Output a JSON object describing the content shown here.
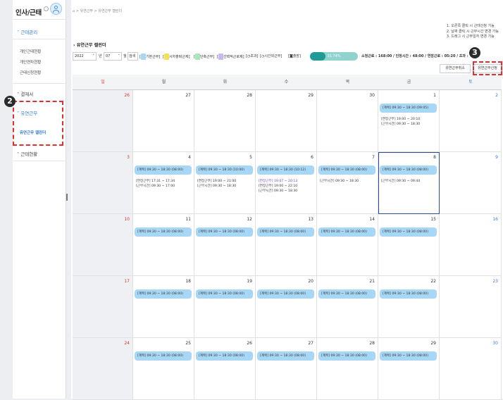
{
  "sidebar": {
    "title": "인사/근태",
    "title_icon": "info-circle-icon",
    "section_label": "근태관리",
    "items": [
      {
        "label": "개인근태현황"
      },
      {
        "label": "개인연차현황"
      },
      {
        "label": "근태신청현황"
      }
    ],
    "approval_label": "결재서",
    "flex_section_label": "유연근무",
    "flex_sub_label": "유연근무 캘린더",
    "status_label": "근태현황"
  },
  "callouts": {
    "two": "2",
    "three": "3"
  },
  "breadcrumb": {
    "home_icon": "home-icon",
    "items": [
      "유연근무",
      "유연근무 캘린더"
    ]
  },
  "page": {
    "title": "유연근무 캘린더"
  },
  "notes": [
    "1. 오른쪽 클릭 시 근태신청 가능",
    "2. 날짜 클릭 시 근무시간 변경 가능",
    "3. 드래그 시 근무일자 변경 가능"
  ],
  "controls": {
    "year": "2022",
    "year_suffix": "년",
    "month": "07",
    "month_suffix": "월",
    "search_label": "검색",
    "legend": [
      {
        "label": "기본근무",
        "color": "#a8d7f6"
      },
      {
        "label": "시차출퇴근제",
        "color": "#f5e04f"
      },
      {
        "label": "단축근무",
        "color": "#a7e8b8"
      },
      {
        "label": "선택적근로제",
        "color": "#c9b8ef"
      }
    ],
    "extra_legend": [
      {
        "icon": "clock-icon",
        "label": "초과"
      },
      {
        "icon": "clock-icon",
        "label": "시간외근무"
      },
      {
        "icon": "car-icon",
        "label": "출장"
      }
    ],
    "progress_text": "31.74%",
    "progress_value": 0.3174,
    "stats": "소정근로 : 168:00 / 인정시간 : 48:00 / 연장근로 : 05:20 / 초과 : ",
    "cancel_button": "유연근무취소",
    "apply_button": "유연근무신청"
  },
  "weekdays": [
    "일",
    "월",
    "화",
    "수",
    "목",
    "금",
    "토"
  ],
  "calendar_weeks": [
    [
      {
        "day": "26",
        "entries": []
      },
      {
        "day": "27",
        "entries": []
      },
      {
        "day": "28",
        "entries": []
      },
      {
        "day": "29",
        "entries": []
      },
      {
        "day": "30",
        "entries": []
      },
      {
        "day": "1",
        "entries": [
          {
            "kind": "pill",
            "text": "[계획] 09:30 ~ 18:30 (09:05)"
          },
          {
            "kind": "line",
            "text": "[연장근무] 19:00 ~ 20:10"
          },
          {
            "kind": "line",
            "text": "[근무시간] 09:30 ~ 18:30"
          }
        ]
      },
      {
        "day": "2",
        "entries": []
      }
    ],
    [
      {
        "day": "3",
        "entries": []
      },
      {
        "day": "4",
        "entries": [
          {
            "kind": "pill",
            "text": "[계획] 09:30 ~ 18:30 (08:00)"
          },
          {
            "kind": "line",
            "text": "[연장근무] 17:31 ~ 17:34"
          },
          {
            "kind": "line",
            "text": "[근무시간] 09:30 ~ 17:00"
          }
        ]
      },
      {
        "day": "5",
        "entries": [
          {
            "kind": "pill",
            "text": "[계획] 09:30 ~ 18:30 (10:00)"
          },
          {
            "kind": "line",
            "text": "[연장근무] 19:00 ~ 21:00"
          },
          {
            "kind": "line",
            "text": "[근무시간] 09:30 ~ 18:30"
          }
        ]
      },
      {
        "day": "6",
        "entries": [
          {
            "kind": "pill",
            "text": "[계획] 09:30 ~ 18:30 (10:12)"
          },
          {
            "kind": "line",
            "style": "purple",
            "text": "[연장근무] 19:07 ~ 20:13"
          },
          {
            "kind": "line",
            "text": "[연장근무] 19:00 ~ 22:10"
          },
          {
            "kind": "line",
            "text": "[근무시간] 09:30 ~ 18:30"
          }
        ]
      },
      {
        "day": "7",
        "entries": [
          {
            "kind": "pill",
            "text": "[계획] 09:30 ~ 18:30 (08:00)"
          },
          {
            "kind": "line",
            "text": "[근무시간] 09:30 ~ 18:30"
          }
        ]
      },
      {
        "day": "8",
        "today": true,
        "entries": [
          {
            "kind": "pill",
            "text": "[계획] 09:30 ~ 18:30 (08:00)"
          },
          {
            "kind": "line",
            "text": "[근무시간] 09:30 ~ 09:44"
          }
        ]
      },
      {
        "day": "9",
        "entries": []
      }
    ],
    [
      {
        "day": "10",
        "entries": []
      },
      {
        "day": "11",
        "entries": [
          {
            "kind": "pill",
            "text": "[계획] 09:30 ~ 18:30 (08:00)"
          }
        ]
      },
      {
        "day": "12",
        "entries": [
          {
            "kind": "pill",
            "text": "[계획] 09:30 ~ 18:30 (08:00)"
          }
        ]
      },
      {
        "day": "13",
        "entries": [
          {
            "kind": "pill",
            "text": "[계획] 09:30 ~ 18:30 (08:00)"
          }
        ]
      },
      {
        "day": "14",
        "entries": [
          {
            "kind": "pill",
            "text": "[계획] 09:30 ~ 18:30 (08:00)"
          }
        ]
      },
      {
        "day": "15",
        "entries": [
          {
            "kind": "pill",
            "text": "[계획] 09:30 ~ 18:30 (08:00)"
          }
        ]
      },
      {
        "day": "16",
        "entries": []
      }
    ],
    [
      {
        "day": "17",
        "entries": []
      },
      {
        "day": "18",
        "entries": [
          {
            "kind": "pill",
            "text": "[계획] 09:30 ~ 18:30 (08:00)"
          }
        ]
      },
      {
        "day": "19",
        "entries": [
          {
            "kind": "pill",
            "text": "[계획] 09:30 ~ 18:30 (08:00)"
          }
        ]
      },
      {
        "day": "20",
        "entries": [
          {
            "kind": "pill",
            "text": "[계획] 09:30 ~ 18:30 (08:00)"
          }
        ]
      },
      {
        "day": "21",
        "entries": [
          {
            "kind": "pill",
            "text": "[계획] 09:30 ~ 18:30 (08:00)"
          }
        ]
      },
      {
        "day": "22",
        "entries": [
          {
            "kind": "pill",
            "text": "[계획] 09:30 ~ 18:30 (08:00)"
          }
        ]
      },
      {
        "day": "23",
        "entries": []
      }
    ],
    [
      {
        "day": "24",
        "entries": []
      },
      {
        "day": "25",
        "entries": [
          {
            "kind": "pill",
            "text": "[계획] 09:30 ~ 18:30 (08:00)"
          }
        ]
      },
      {
        "day": "26",
        "entries": [
          {
            "kind": "pill",
            "text": "[계획] 09:30 ~ 18:30 (08:00)"
          }
        ]
      },
      {
        "day": "27",
        "entries": [
          {
            "kind": "pill",
            "text": "[계획] 09:30 ~ 18:30 (08:00)"
          }
        ]
      },
      {
        "day": "28",
        "entries": [
          {
            "kind": "pill",
            "text": "[계획] 09:30 ~ 18:30 (08:00)"
          }
        ]
      },
      {
        "day": "29",
        "entries": [
          {
            "kind": "pill",
            "text": "[계획] 09:30 ~ 18:30 (08:00)"
          }
        ]
      },
      {
        "day": "30",
        "entries": []
      }
    ]
  ]
}
